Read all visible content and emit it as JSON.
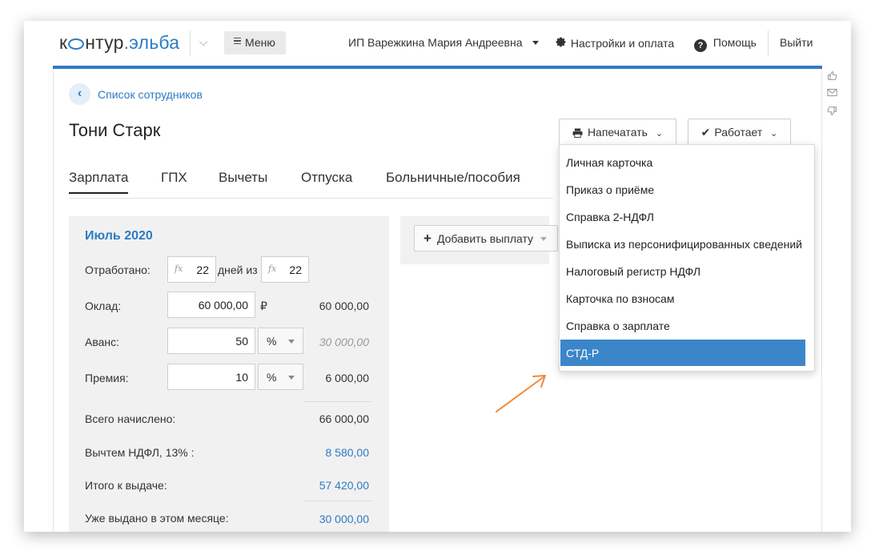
{
  "header": {
    "logo_left": "к",
    "logo_mid": "нтур",
    "logo_right": ".эльба",
    "menu_label": "Меню",
    "user_name": "ИП Варежкина Мария Андреевна",
    "settings_label": "Настройки и оплата",
    "help_label": "Помощь",
    "logout_label": "Выйти"
  },
  "breadcrumb": {
    "back_label": "Список сотрудников"
  },
  "page": {
    "title": "Тони Старк"
  },
  "actions": {
    "print_label": "Напечатать",
    "status_label": "Работает"
  },
  "tabs": [
    {
      "label": "Зарплата",
      "active": true
    },
    {
      "label": "ГПХ"
    },
    {
      "label": "Вычеты"
    },
    {
      "label": "Отпуска"
    },
    {
      "label": "Больничные/пособия"
    }
  ],
  "salary": {
    "month": "Июль 2020",
    "worked_label": "Отработано:",
    "worked_days": "22",
    "days_of_label": "дней из",
    "total_days": "22",
    "fx_symbol": "fx",
    "salary_label": "Оклад:",
    "salary_value": "60 000,00",
    "currency": "₽",
    "salary_total": "60 000,00",
    "advance_label": "Аванс:",
    "advance_value": "50",
    "advance_unit": "%",
    "advance_total": "30 000,00",
    "bonus_label": "Премия:",
    "bonus_value": "10",
    "bonus_unit": "%",
    "bonus_total": "6 000,00",
    "accrued_label": "Всего начислено:",
    "accrued_value": "66 000,00",
    "ndfl_label": "Вычтем НДФЛ, 13% :",
    "ndfl_value": "8 580,00",
    "payout_label": "Итого к выдаче:",
    "payout_value": "57 420,00",
    "paid_label": "Уже выдано в этом месяце:",
    "paid_value": "30 000,00"
  },
  "add_payment_label": "Добавить выплату",
  "print_menu": [
    "Личная карточка",
    "Приказ о приёме",
    "Справка 2-НДФЛ",
    "Выписка из персонифицированных сведений",
    "Налоговый регистр НДФЛ",
    "Карточка по взносам",
    "Справка о зарплате",
    "СТД-Р"
  ],
  "print_menu_selected": "СТД-Р",
  "colors": {
    "accent": "#2d7bc4",
    "selected": "#3b86c9",
    "arrow": "#f08a3c"
  },
  "icons": [
    "chevron-down-icon",
    "menu-icon",
    "gear-icon",
    "help-icon",
    "printer-icon",
    "check-icon",
    "plus-icon",
    "like-icon",
    "mail-icon",
    "dislike-icon"
  ]
}
